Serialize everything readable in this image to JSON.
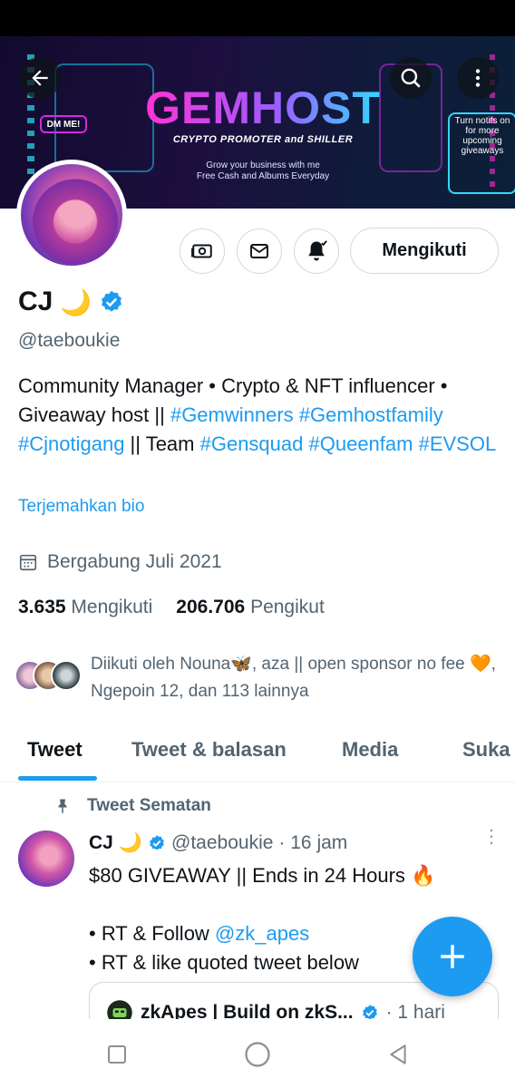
{
  "banner": {
    "title": "GEMHOST",
    "subtitle": "CRYPTO PROMOTER and SHILLER",
    "tagline_line1": "Grow your business with me",
    "tagline_line2": "Free Cash and Albums Everyday",
    "dm_badge": "DM ME!",
    "notif_note": "Turn notifs on for more upcoming giveaways"
  },
  "header": {
    "back_icon": "arrow-left-icon",
    "search_icon": "search-icon",
    "more_icon": "more-vertical-icon"
  },
  "profile": {
    "name": "CJ",
    "name_emoji": "🌙",
    "handle": "@taeboukie",
    "follow_button": "Mengikuti",
    "bio_text_1": "Community Manager • Crypto & NFT influencer • Giveaway host || ",
    "bio_tag_1": "#Gemwinners",
    "bio_tag_2": "#Gemhostfamily",
    "bio_tag_3": "#Cjnotigang",
    "bio_text_2": " || Team ",
    "bio_tag_4": "#Gensquad",
    "bio_tag_5": "#Queenfam",
    "bio_tag_6": "#EVSOL",
    "translate_bio": "Terjemahkan bio",
    "joined": "Bergabung Juli 2021",
    "following_count": "3.635",
    "following_label": "Mengikuti",
    "followers_count": "206.706",
    "followers_label": "Pengikut",
    "followed_by": "Diikuti oleh Nouna🦋, aza || open sponsor no fee 🧡, Ngepoin 12, dan 113 lainnya"
  },
  "tabs": [
    {
      "label": "Tweet",
      "active": true
    },
    {
      "label": "Tweet & balasan",
      "active": false
    },
    {
      "label": "Media",
      "active": false
    },
    {
      "label": "Suka",
      "active": false
    }
  ],
  "pinned_tweet": {
    "pinned_label": "Tweet Sematan",
    "author_name": "CJ",
    "author_emoji": "🌙",
    "author_handle": "@taeboukie",
    "time": "· 16 jam",
    "line1": "$80 GIVEAWAY || Ends in 24 Hours 🔥",
    "line2_prefix": "• RT & Follow ",
    "mention": "@zk_apes",
    "line3": "• RT & like quoted tweet below",
    "quote_name": "zkApes | Build on zkS...",
    "quote_time": "· 1 hari"
  },
  "colors": {
    "accent": "#1d9bf0",
    "text": "#0f1419",
    "muted": "#536471",
    "border": "#cfd9de"
  }
}
